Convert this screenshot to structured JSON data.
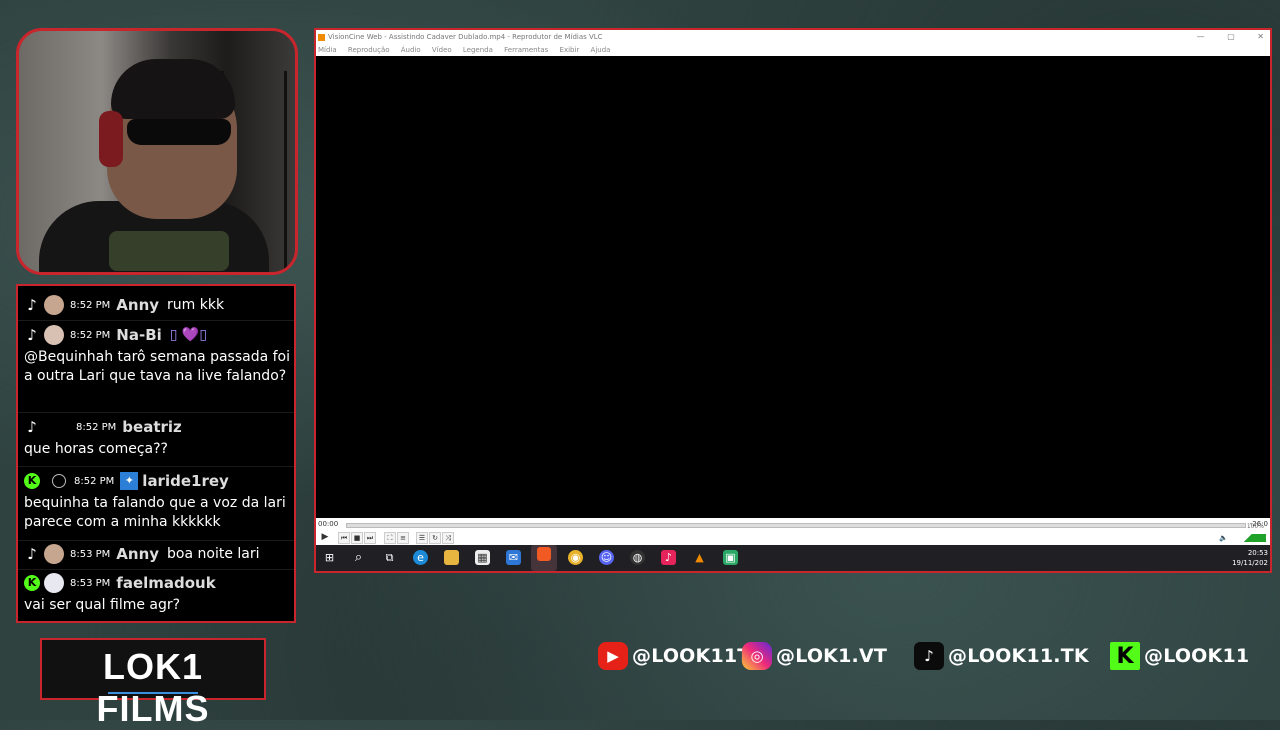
{
  "chat": {
    "messages": [
      {
        "platform": "tiktok",
        "time": "8:52 PM",
        "user": "Anny",
        "text": "rum kkk"
      },
      {
        "platform": "tiktok",
        "time": "8:52 PM",
        "user": "Na-Bi",
        "badges": "▯ 💜▯",
        "text": "@Bequinhah tarô semana passada foi a outra Lari que tava na live falando?"
      },
      {
        "platform": "tiktok",
        "time": "8:52 PM",
        "user": "beatriz",
        "text": "que horas começa??"
      },
      {
        "platform": "kick",
        "time": "8:52 PM",
        "user": "laride1rey",
        "text": "bequinha ta falando que a voz da lari parece com a minha kkkkkk"
      },
      {
        "platform": "tiktok",
        "time": "8:53 PM",
        "user": "Anny",
        "text": "boa noite lari"
      },
      {
        "platform": "kick",
        "time": "8:53 PM",
        "user": "faelmadouk",
        "text": "vai ser qual filme agr?"
      }
    ]
  },
  "logo": {
    "text": "LOK1 FILMS"
  },
  "vlc": {
    "title": "VisionCine Web - Assistindo Cadaver Dublado.mp4 - Reprodutor de Mídias VLC",
    "menu": [
      "Mídia",
      "Reprodução",
      "Áudio",
      "Vídeo",
      "Legenda",
      "Ferramentas",
      "Exibir",
      "Ajuda"
    ],
    "time_elapsed": "00:00",
    "time_total": "-26:0",
    "volume": "100%",
    "clock_time": "20:53",
    "clock_date": "19/11/202"
  },
  "socials": [
    {
      "platform": "youtube",
      "handle": "@LOOK11TV",
      "color": "#ff0000"
    },
    {
      "platform": "instagram",
      "handle": "@LOK1.VT",
      "color": "#d6287b"
    },
    {
      "platform": "tiktok",
      "handle": "@LOOK11.TK",
      "color": "#111111"
    },
    {
      "platform": "kick",
      "handle": "@LOOK11",
      "color": "#53fc18"
    }
  ],
  "colors": {
    "frame_red": "#c9252c",
    "kick_green": "#53fc18",
    "vlc_orange": "#f08a00"
  }
}
